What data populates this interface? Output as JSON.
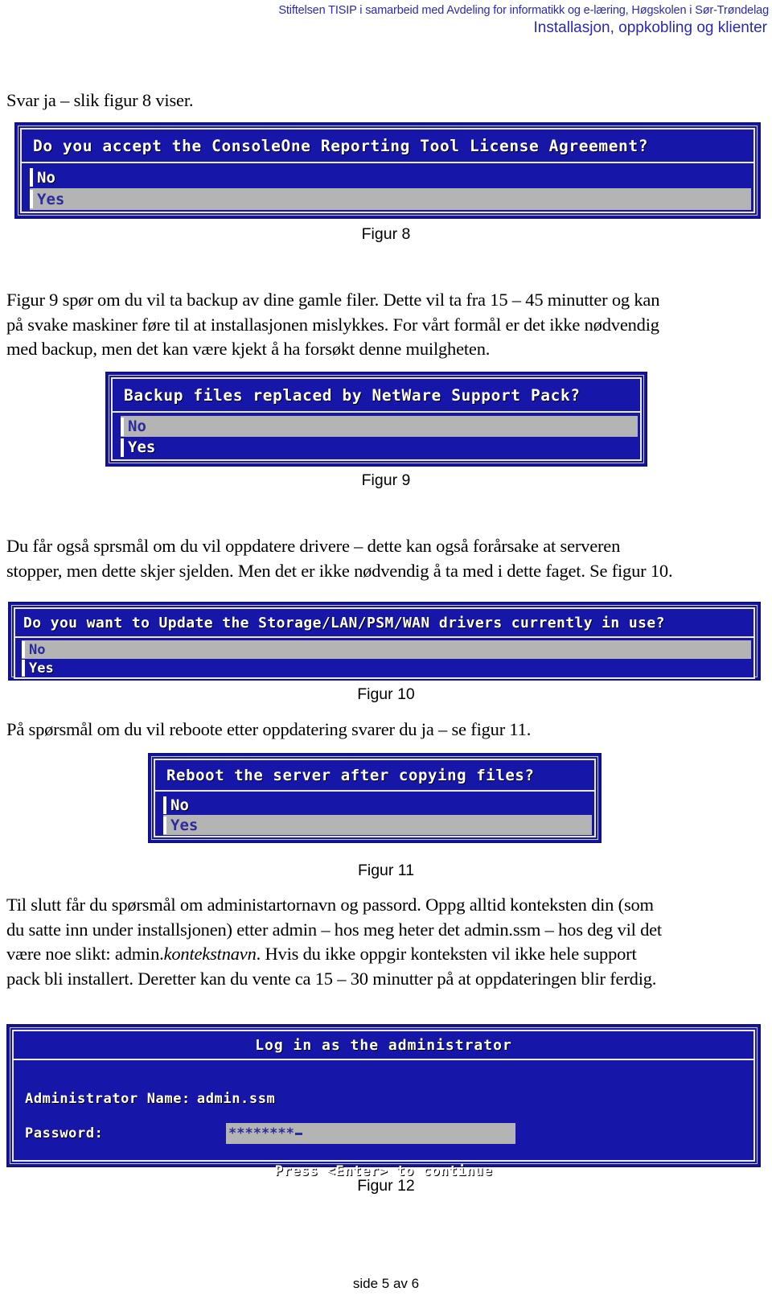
{
  "header": {
    "line1": "Stiftelsen TISIP i samarbeid med Avdeling for informatikk og e-læring, Høgskolen i Sør-Trøndelag",
    "line2": "Installasjon, oppkobling og klienter"
  },
  "paragraphs": {
    "p1": "Svar ja – slik figur 8 viser.",
    "p2_line1": "Figur 9 spør om du vil ta backup av dine gamle filer. Dette vil ta fra 15 – 45 minutter og kan",
    "p2_line2": "på svake maskiner føre til at installasjonen mislykkes. For vårt formål er det ikke nødvendig",
    "p2_line3": "med backup, men det kan være kjekt å ha forsøkt denne muilgheten.",
    "p3_line1": "Du får også sprsmål om du vil oppdatere drivere – dette kan også forårsake at serveren",
    "p3_line2": "stopper, men dette skjer sjelden. Men det er ikke nødvendig å ta med i dette faget. Se figur 10.",
    "p4": "På spørsmål om du vil reboote etter oppdatering svarer du ja – se figur 11.",
    "p5_line1": "Til slutt får du spørsmål om administartornavn og passord. Oppg alltid konteksten din (som",
    "p5_line2": "du satte inn under installsjonen) etter admin – hos meg heter det admin.ssm – hos deg vil det",
    "p5_line3a": "være noe slikt: admin.",
    "p5_line3_italic": "kontekstnavn",
    "p5_line3b": ".  Hvis du ikke oppgir konteksten vil ikke hele support",
    "p5_line4": "pack bli installert. Deretter kan du vente ca 15 – 30 minutter på at oppdateringen blir ferdig."
  },
  "figures": [
    {
      "caption": "Figur 8",
      "title": "Do you accept the ConsoleOne Reporting Tool License Agreement?",
      "options": [
        {
          "label": "No",
          "selected": false
        },
        {
          "label": "Yes",
          "selected": true
        }
      ]
    },
    {
      "caption": "Figur 9",
      "title": "Backup files replaced by NetWare Support Pack?",
      "options": [
        {
          "label": "No",
          "selected": true
        },
        {
          "label": "Yes",
          "selected": false
        }
      ]
    },
    {
      "caption": "Figur 10",
      "title": "Do you want to Update the Storage/LAN/PSM/WAN drivers currently in use?",
      "options": [
        {
          "label": "No",
          "selected": true
        },
        {
          "label": "Yes",
          "selected": false
        }
      ]
    },
    {
      "caption": "Figur 11",
      "title": "Reboot the server after copying files?",
      "options": [
        {
          "label": "No",
          "selected": false
        },
        {
          "label": "Yes",
          "selected": true
        }
      ]
    },
    {
      "caption": "Figur 12",
      "title": "Log in as the administrator",
      "admin_name_label": "Administrator Name:",
      "admin_name_value": "admin.ssm",
      "password_label": "Password:",
      "password_value": "********",
      "continue_text": "Press <Enter> to continue"
    }
  ],
  "footer": {
    "page_label": "side 5 av 6"
  },
  "colors": {
    "header_blue": "#2a2ab0",
    "dialog_blue": "#1616a8",
    "dialog_border_dark": "#11117e",
    "dialog_border_light": "#ecead0",
    "selection_gray": "#b4b4b4",
    "selection_text": "#2b2b9e"
  }
}
